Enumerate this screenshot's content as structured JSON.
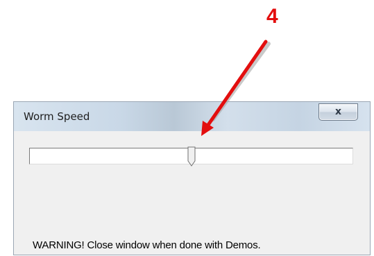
{
  "annotation": {
    "number": "4",
    "color": "#e30e0e"
  },
  "window": {
    "title": "Worm Speed",
    "close_icon": "close-icon",
    "close_glyph": "x"
  },
  "slider": {
    "value_fraction": 0.5
  },
  "warning": "WARNING! Close window when done with Demos."
}
